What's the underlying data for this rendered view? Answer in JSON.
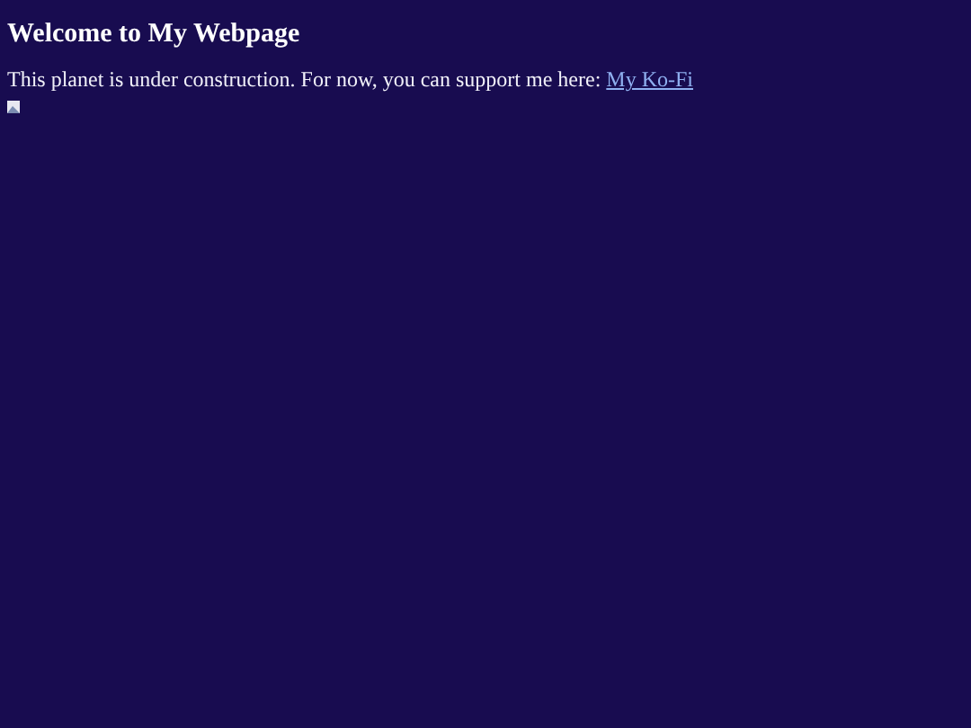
{
  "heading": "Welcome to My Webpage",
  "intro": {
    "text": "This planet is under construction. For now, you can support me here:",
    "link": "My Ko-Fi"
  },
  "image": {
    "kind": "broken-image"
  }
}
